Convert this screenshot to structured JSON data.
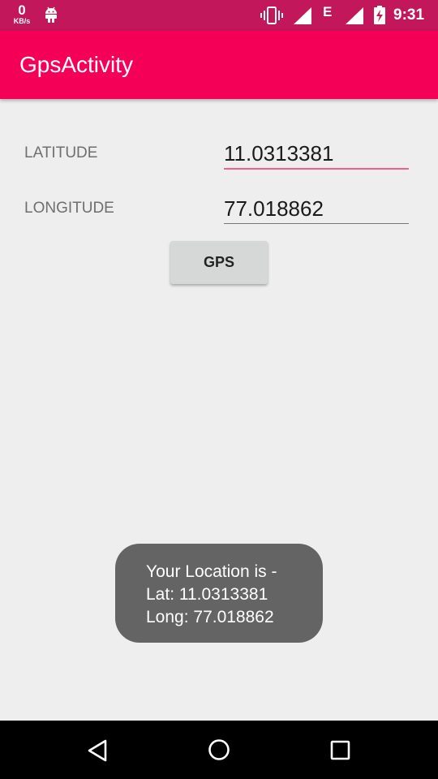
{
  "status_bar": {
    "data_rate_value": "0",
    "data_rate_unit": "KB/s",
    "network_type": "E",
    "time": "9:31",
    "icons": [
      "android-icon",
      "vibrate-icon",
      "signal-icon",
      "battery-icon"
    ]
  },
  "app_bar": {
    "title": "GpsActivity",
    "color": "#f50057"
  },
  "form": {
    "latitude_label": "LATITUDE",
    "latitude_value": "11.0313381",
    "longitude_label": "LONGITUDE",
    "longitude_value": "77.018862",
    "gps_button_label": "GPS"
  },
  "toast": {
    "line1": "Your Location is -",
    "line2": "Lat: 11.0313381",
    "line3": "Long: 77.018862"
  },
  "nav_bar": {
    "icons": [
      "back-icon",
      "home-icon",
      "recents-icon"
    ]
  },
  "colors": {
    "status_bar": "#c2185b",
    "accent": "#f06292",
    "background": "#eeeeee"
  }
}
